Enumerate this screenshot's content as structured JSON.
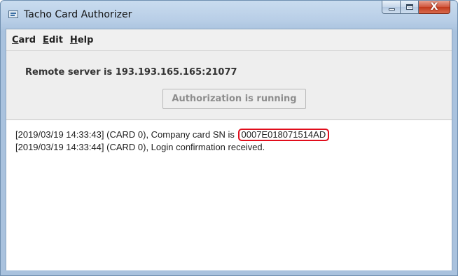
{
  "window": {
    "title": "Tacho Card Authorizer",
    "close_glyph": "X"
  },
  "menu": [
    "Card",
    "Edit",
    "Help"
  ],
  "server_status": "Remote server is 193.193.165.165:21077",
  "auth_button_label": "Authorization is running",
  "log": {
    "line1_prefix": "[2019/03/19 14:33:43] (CARD 0), Company card SN is ",
    "line1_sn": "0007E018071514AD",
    "line2": "[2019/03/19 14:33:44] (CARD 0), Login confirmation received."
  },
  "colors": {
    "highlight": "#e10d1c",
    "title_bar": "#b7cde6",
    "close_button": "#c23a1d"
  },
  "icons": [
    "app-icon",
    "minimize-icon",
    "maximize-icon",
    "close-icon"
  ]
}
